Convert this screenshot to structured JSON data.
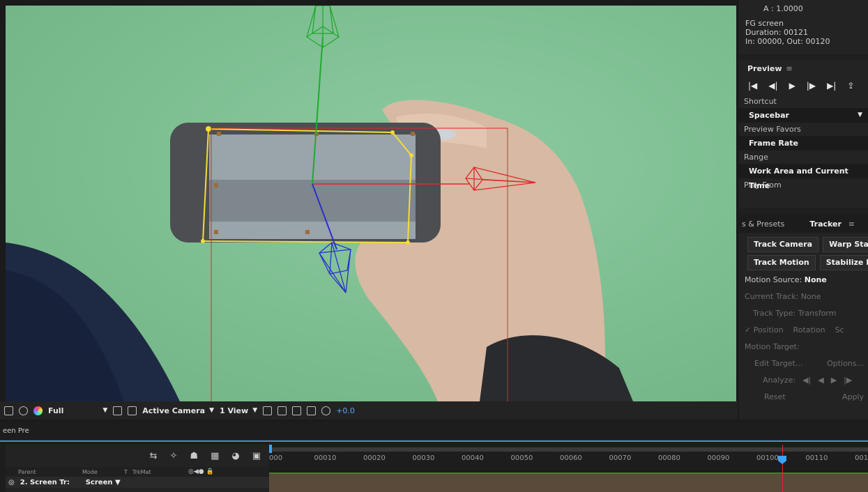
{
  "project_info": {
    "alpha": "A : 1.0000",
    "name": "FG screen",
    "duration": "Duration: 00121",
    "in_out": "In: 00000, Out: 00120"
  },
  "preview": {
    "title": "Preview",
    "menu_icon": "hamburger-icon",
    "shortcut_label": "Shortcut",
    "shortcut_value": "Spacebar",
    "favors_label": "Preview Favors",
    "favors_value": "Frame Rate",
    "range_label": "Range",
    "range_value": "Work Area and Current Time",
    "play_from_label": "Play From"
  },
  "tracker": {
    "tab_left": "s & Presets",
    "tab_active": "Tracker",
    "track_camera": "Track Camera",
    "warp_stabilizer": "Warp Stabil",
    "track_motion": "Track Motion",
    "stabilize_motion": "Stabilize Mo",
    "motion_source_label": "Motion Source:",
    "motion_source_value": "None",
    "current_track": "Current Track:  None",
    "track_type": "Track Type:  Transform",
    "position": "✓ Position",
    "rotation": "Rotation",
    "scale": "Sc",
    "motion_target": "Motion Target:",
    "edit_target": "Edit Target...",
    "options": "Options...",
    "analyze": "Analyze:",
    "reset": "Reset",
    "apply": "Apply"
  },
  "viewer_toolbar": {
    "resolution": "Full",
    "camera": "Active Camera",
    "views": "1 View",
    "exposure": "+0.0"
  },
  "timeline": {
    "tab": "een Pre",
    "columns": [
      "Parent",
      "Mode",
      "T",
      "TrkMat"
    ],
    "layer": {
      "name": "2. Screen Tr:",
      "mode": "Screen"
    },
    "ruler": [
      "000",
      "00010",
      "00020",
      "00030",
      "00040",
      "00050",
      "00060",
      "00070",
      "00080",
      "00090",
      "00100",
      "00110",
      "001"
    ]
  },
  "colors": {
    "track_box": "#f2dd3a",
    "camera_red": "#e2262a",
    "camera_green": "#1faa2e",
    "camera_blue": "#2b2fd0",
    "playhead_blue": "#3ba3ff",
    "accent_text": "#4ea9ff"
  }
}
